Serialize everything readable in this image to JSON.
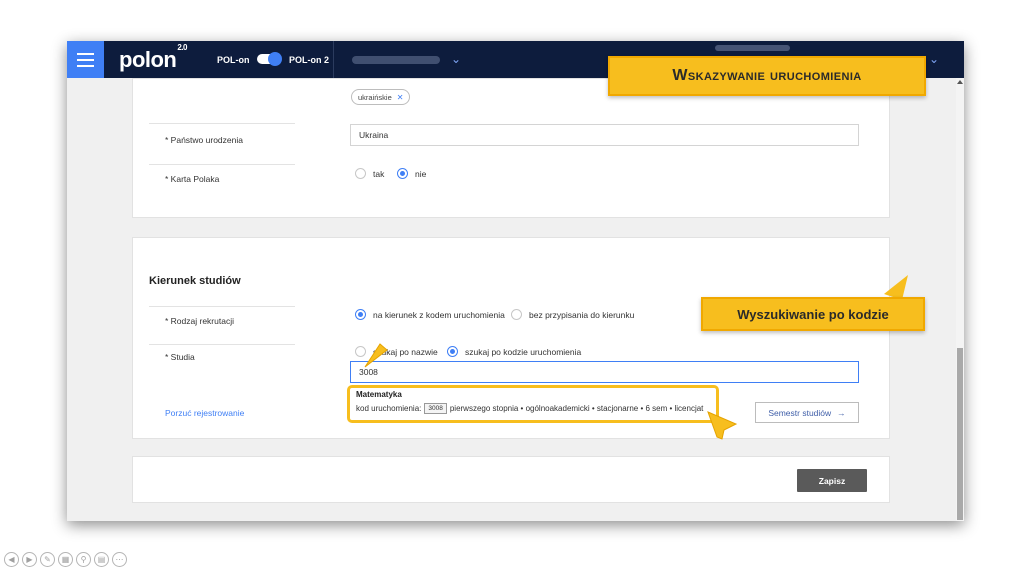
{
  "topbar": {
    "logo_text": "polon",
    "logo_version": "2.0",
    "toggle_left": "POL-on",
    "toggle_right": "POL-on 2"
  },
  "form": {
    "chip_label": "ukraińskie",
    "birth_country_label": "* Państwo urodzenia",
    "birth_country_value": "Ukraina",
    "pole_card_label": "* Karta Polaka",
    "pole_card_options": [
      "tak",
      "nie"
    ],
    "pole_card_selected": "nie"
  },
  "studies": {
    "section_title": "Kierunek studiów",
    "recruitment_label": "* Rodzaj rekrutacji",
    "recruitment_options": [
      "na kierunek z kodem uruchomienia",
      "bez przypisania do kierunku"
    ],
    "studies_label": "* Studia",
    "search_options": [
      "szukaj po nazwie",
      "szukaj po kodzie uruchomienia"
    ],
    "search_value": "3008",
    "result_title": "Matematyka",
    "result_prefix": "kod uruchomienia:",
    "result_code": "3008",
    "result_details": "pierwszego stopnia • ogólnoakademicki • stacjonarne • 6 sem • licencjat",
    "cancel_link": "Porzuć rejestrowanie",
    "semester_button": "Semestr studiów",
    "semester_arrow": "→"
  },
  "footer": {
    "save_button": "Zapisz"
  },
  "callouts": {
    "title": "Wskazywanie uruchomienia",
    "search_by_code": "Wyszukiwanie po kodzie"
  },
  "colors": {
    "topbar": "#0d1c3d",
    "accent": "#3f7ff5",
    "callout": "#f7be1e"
  }
}
